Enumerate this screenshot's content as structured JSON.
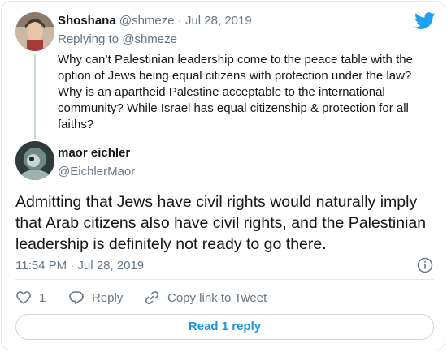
{
  "parent": {
    "name": "Shoshana",
    "handle": "@shmeze",
    "separator": "·",
    "date": "Jul 28, 2019",
    "replying_to": "Replying to @shmeze",
    "text": "Why can’t Palestinian leadership come to the peace table with the option of Jews being equal citizens with protection under the law? Why is an apartheid Palestine acceptable to the international community? While Israel has equal citizenship & protection for all faiths?"
  },
  "tweet": {
    "name": "maor eichler",
    "handle": "@EichlerMaor",
    "text": "Admitting that Jews have civil rights would naturally imply that Arab citizens also have civil rights, and the Palestinian leadership is definitely not ready to go there.",
    "timestamp": "11:54 PM · Jul 28, 2019"
  },
  "actions": {
    "like_count": "1",
    "reply_label": "Reply",
    "copy_label": "Copy link to Tweet"
  },
  "read_replies_label": "Read 1 reply",
  "icons": [
    "twitter-bird-icon",
    "info-icon",
    "heart-icon",
    "reply-icon",
    "link-icon"
  ],
  "colors": {
    "brand": "#1da1f2",
    "link": "#1b95e0",
    "muted": "#657786",
    "border": "#e1e8ed"
  }
}
